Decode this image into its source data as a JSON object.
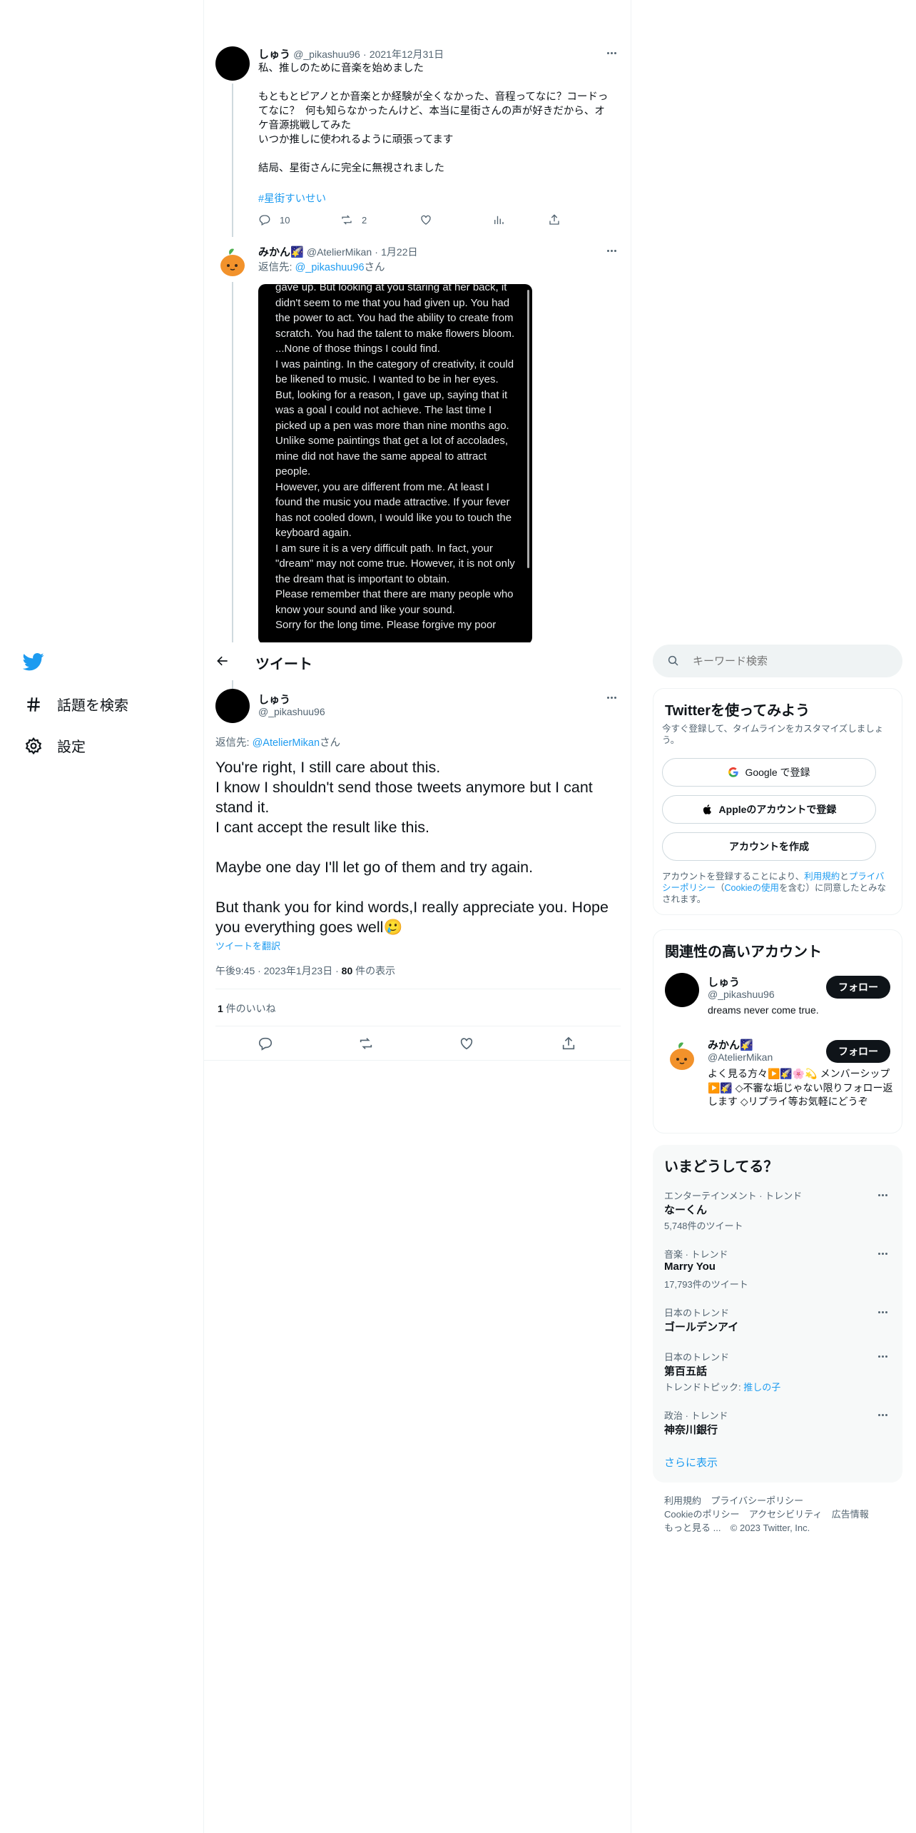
{
  "left_nav": {
    "explore": "話題を検索",
    "settings": "設定"
  },
  "header": {
    "title": "ツイート"
  },
  "thread": {
    "tweet1": {
      "name": "しゅう",
      "handle": "@_pikashuu96",
      "sep": "·",
      "date": "2021年12月31日",
      "text": "私、推しのために音楽を始めました\n\nもともとピアノとか音楽とか経験が全くなかった、音程ってなに？コードってなに？  何も知らなかったんけど、本当に星街さんの声が好きだから、オケ音源挑戦してみた\nいつか推しに使われるように頑張ってます\n\n結局、星街さんに完全に無視されました",
      "hashtag": "#星街すいせい",
      "replies": "10",
      "retweets": "2"
    },
    "tweet2": {
      "name": "みかん🌠",
      "handle": "@AtelierMikan",
      "sep": "·",
      "date": "1月22日",
      "reply_prefix": "返信先: ",
      "reply_to": "@_pikashuu96",
      "reply_suffix": "さん",
      "image_text": "gave up. But looking at you staring at her back, it didn't seem to me that you had given up. You had the power to act. You had the ability to create from scratch. You had the talent to make flowers bloom.\n...None of those things I could find.\nI was painting. In the category of creativity, it could be likened to music. I wanted to be in her eyes. But, looking for a reason, I gave up, saying that it was a goal I could not achieve. The last time I picked up a pen was more than nine months ago. Unlike some paintings that get a lot of accolades, mine did not have the same appeal to attract people.\nHowever, you are different from me. At least I found the music you made attractive. If your fever has not cooled down, I would like you to touch the keyboard again.\nI am sure it is a very difficult path. In fact, your \"dream\" may not come true. However, it is not only the dream that is important to obtain.\nPlease remember that there are many people who know your sound and like your sound.\nSorry for the long time. Please forgive my poor"
    }
  },
  "main_tweet": {
    "name": "しゅう",
    "handle": "@_pikashuu96",
    "reply_prefix": "返信先: ",
    "reply_to": "@AtelierMikan",
    "reply_suffix": "さん",
    "text": "You're right, I still care about this.\nI know I shouldn't send those tweets anymore but I cant stand it.\nI cant accept the result like this.\n\nMaybe one day I'll let go of them and try again.\n\nBut thank you for kind words,I really appreciate you. Hope you everything goes well🥲",
    "translate": "ツイートを翻訳",
    "time": "午後9:45",
    "sep": "·",
    "date": "2023年1月23日",
    "views_count": "80",
    "views_label": " 件の表示",
    "likes_count": "1",
    "likes_label": " 件のいいね"
  },
  "sidebar": {
    "search_placeholder": "キーワード検索",
    "signup": {
      "title": "Twitterを使ってみよう",
      "subtitle": "今すぐ登録して、タイムラインをカスタマイズしましょう。",
      "google": "Google で登録",
      "apple": "Appleのアカウントで登録",
      "create": "アカウントを作成",
      "legal_pre": "アカウントを登録することにより、",
      "terms": "利用規約",
      "and": "と",
      "privacy": "プライバシーポリシー",
      "paren_open": "（",
      "cookie": "Cookieの使用",
      "paren_close": "を含む）に同意したとみなされます。"
    },
    "related": {
      "title": "関連性の高いアカウント",
      "accounts": [
        {
          "name": "しゅう",
          "handle": "@_pikashuu96",
          "bio": "dreams never come true.",
          "follow": "フォロー"
        },
        {
          "name": "みかん🌠",
          "handle": "@AtelierMikan",
          "bio": "よく見る方々▶️🌠🌸💫 メンバーシップ▶️🌠 ◇不審な垢じゃない限りフォロー返します ◇リプライ等お気軽にどうぞ",
          "follow": "フォロー"
        }
      ]
    },
    "trends": {
      "title": "いまどうしてる？",
      "items": [
        {
          "meta": "エンターテインメント · トレンド",
          "name": "なーくん",
          "count": "5,748件のツイート"
        },
        {
          "meta": "音楽 · トレンド",
          "name": "Marry You",
          "count": "17,793件のツイート"
        },
        {
          "meta": "日本のトレンド",
          "name": "ゴールデンアイ",
          "count": ""
        },
        {
          "meta": "日本のトレンド",
          "name": "第百五話",
          "count_prefix": "トレンドトピック: ",
          "count_link": "推しの子"
        },
        {
          "meta": "政治 · トレンド",
          "name": "神奈川銀行",
          "count": ""
        }
      ],
      "more": "さらに表示"
    },
    "footer": {
      "terms": "利用規約",
      "privacy": "プライバシーポリシー",
      "cookie": "Cookieのポリシー",
      "accessibility": "アクセシビリティ",
      "ads": "広告情報",
      "more": "もっと見る ...",
      "copyright": "© 2023 Twitter, Inc."
    }
  },
  "colors": {
    "accent": "#1d9bf0",
    "text": "#0f1419",
    "muted": "#536471",
    "border": "#eff3f4"
  }
}
